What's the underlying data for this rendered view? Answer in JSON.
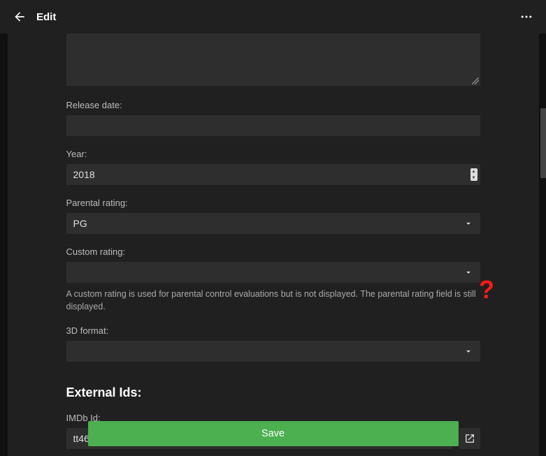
{
  "header": {
    "title": "Edit"
  },
  "fields": {
    "release_date": {
      "label": "Release date:",
      "value": ""
    },
    "year": {
      "label": "Year:",
      "value": "2018"
    },
    "parental_rating": {
      "label": "Parental rating:",
      "value": "PG"
    },
    "custom_rating": {
      "label": "Custom rating:",
      "value": "",
      "hint": "A custom rating is used for parental control evaluations but is not displayed. The parental rating field is still displayed."
    },
    "format_3d": {
      "label": "3D format:",
      "value": ""
    }
  },
  "external_ids": {
    "section_title": "External Ids:",
    "imdb": {
      "label": "IMDb Id:",
      "value": "tt4633694"
    }
  },
  "buttons": {
    "save": "Save"
  },
  "overlay": {
    "help": "?"
  }
}
